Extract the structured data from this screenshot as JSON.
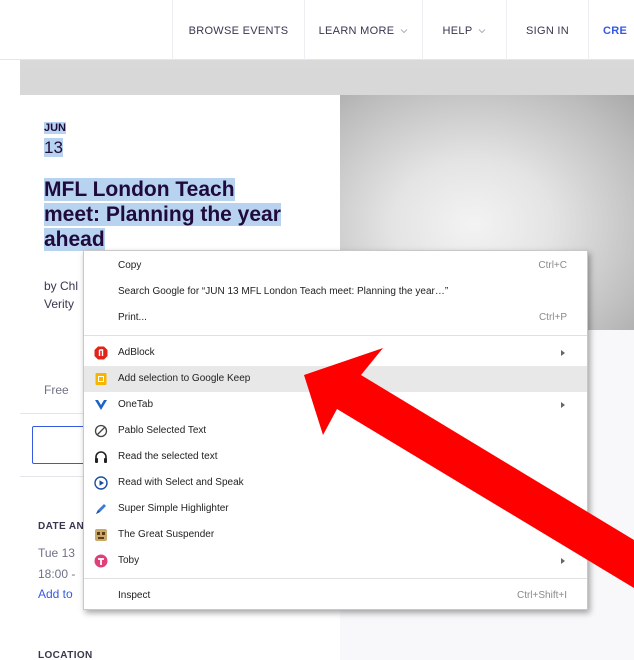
{
  "nav": {
    "browse_events": "BROWSE EVENTS",
    "learn_more": "LEARN MORE",
    "help": "HELP",
    "sign_in": "SIGN IN",
    "create": "CRE"
  },
  "event": {
    "month": "JUN",
    "day": "13",
    "title_line1": "MFL London Teach",
    "title_line2": "meet: Planning the year",
    "title_line3": "ahead",
    "by_line1": "by Chl",
    "by_line2": "Verity",
    "price": "Free"
  },
  "details": {
    "date_heading": "DATE AN",
    "date_line1": "Tue 13",
    "date_line2": "18:00 -",
    "add_to_calendar": "Add to",
    "location_heading": "LOCATION"
  },
  "context_menu": {
    "copy": "Copy",
    "copy_shortcut": "Ctrl+C",
    "search_google": "Search Google for “JUN 13 MFL London Teach meet: Planning the year…”",
    "print": "Print...",
    "print_shortcut": "Ctrl+P",
    "extensions": [
      {
        "label": "AdBlock",
        "icon": "adblock-icon",
        "submenu": true
      },
      {
        "label": "Add selection to Google Keep",
        "icon": "google-keep-icon",
        "submenu": false,
        "highlighted": true
      },
      {
        "label": "OneTab",
        "icon": "onetab-icon",
        "submenu": true
      },
      {
        "label": "Pablo Selected Text",
        "icon": "pablo-icon",
        "submenu": false
      },
      {
        "label": "Read the selected text",
        "icon": "headphones-icon",
        "submenu": false
      },
      {
        "label": "Read with Select and Speak",
        "icon": "play-circle-icon",
        "submenu": false
      },
      {
        "label": "Super Simple Highlighter",
        "icon": "highlighter-icon",
        "submenu": false
      },
      {
        "label": "The Great Suspender",
        "icon": "suspender-icon",
        "submenu": false
      },
      {
        "label": "Toby",
        "icon": "toby-icon",
        "submenu": true
      }
    ],
    "inspect": "Inspect",
    "inspect_shortcut": "Ctrl+Shift+I"
  },
  "colors": {
    "selection": "#b8d3f0",
    "arrow": "#ff0000",
    "brand_blue": "#3659e3"
  }
}
